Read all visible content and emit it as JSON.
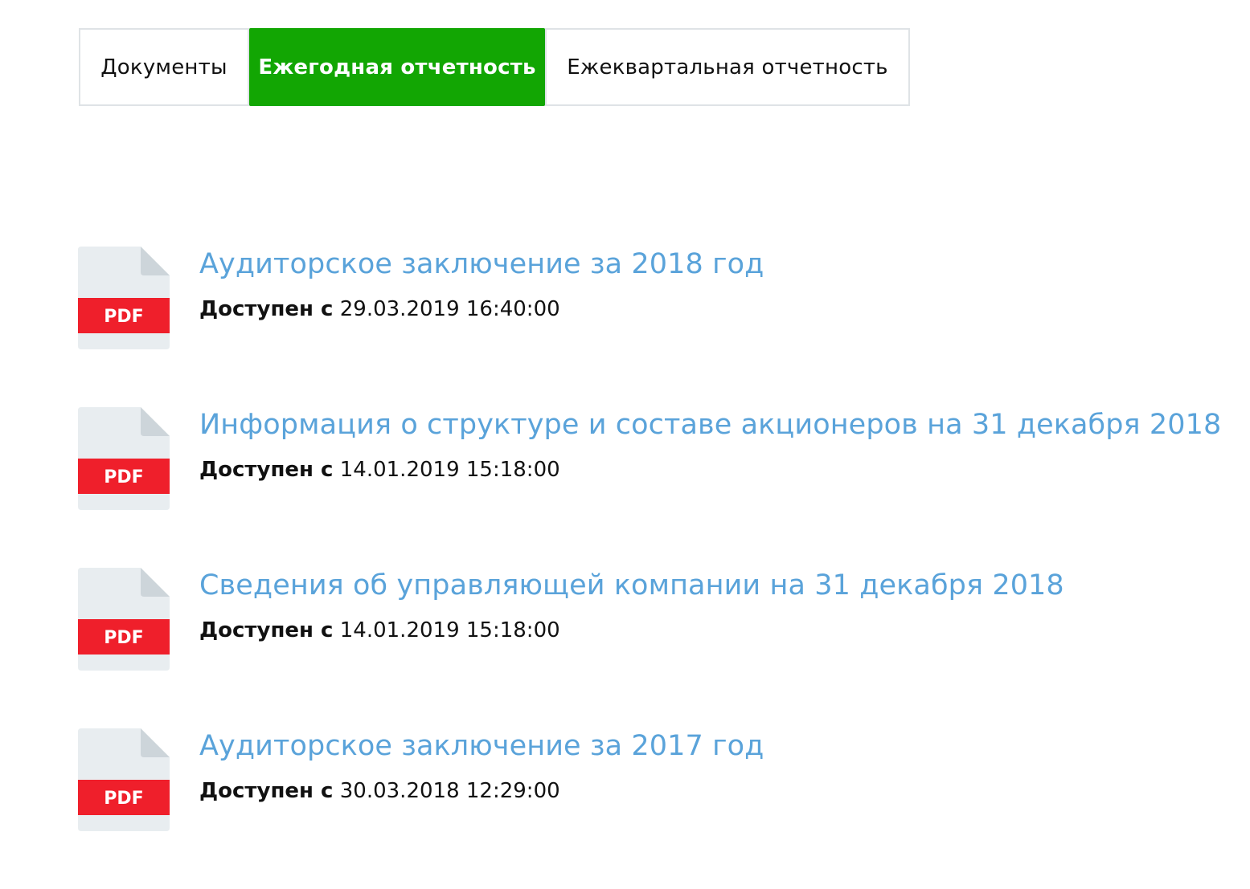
{
  "tabs": [
    {
      "label": "Документы",
      "active": false
    },
    {
      "label": "Ежегодная отчетность",
      "active": true
    },
    {
      "label": "Ежеквартальная отчетность",
      "active": false
    }
  ],
  "icon": {
    "name": "pdf-file-icon",
    "label": "PDF",
    "band_color": "#ef1f2b",
    "page_color": "#e8edf0",
    "fold_color": "#cdd5da"
  },
  "colors": {
    "accent": "#12a603",
    "link": "#5aa3da"
  },
  "documents": [
    {
      "title": "Аудиторское заключение за 2018 год",
      "available_label": "Доступен с",
      "available_date": "29.03.2019 16:40:00"
    },
    {
      "title": "Информация о структуре и составе акционеров на 31 декабря 2018",
      "available_label": "Доступен с",
      "available_date": "14.01.2019 15:18:00"
    },
    {
      "title": "Сведения об управляющей компании на 31 декабря 2018",
      "available_label": "Доступен с",
      "available_date": "14.01.2019 15:18:00"
    },
    {
      "title": "Аудиторское заключение за 2017 год",
      "available_label": "Доступен с",
      "available_date": "30.03.2018 12:29:00"
    }
  ]
}
